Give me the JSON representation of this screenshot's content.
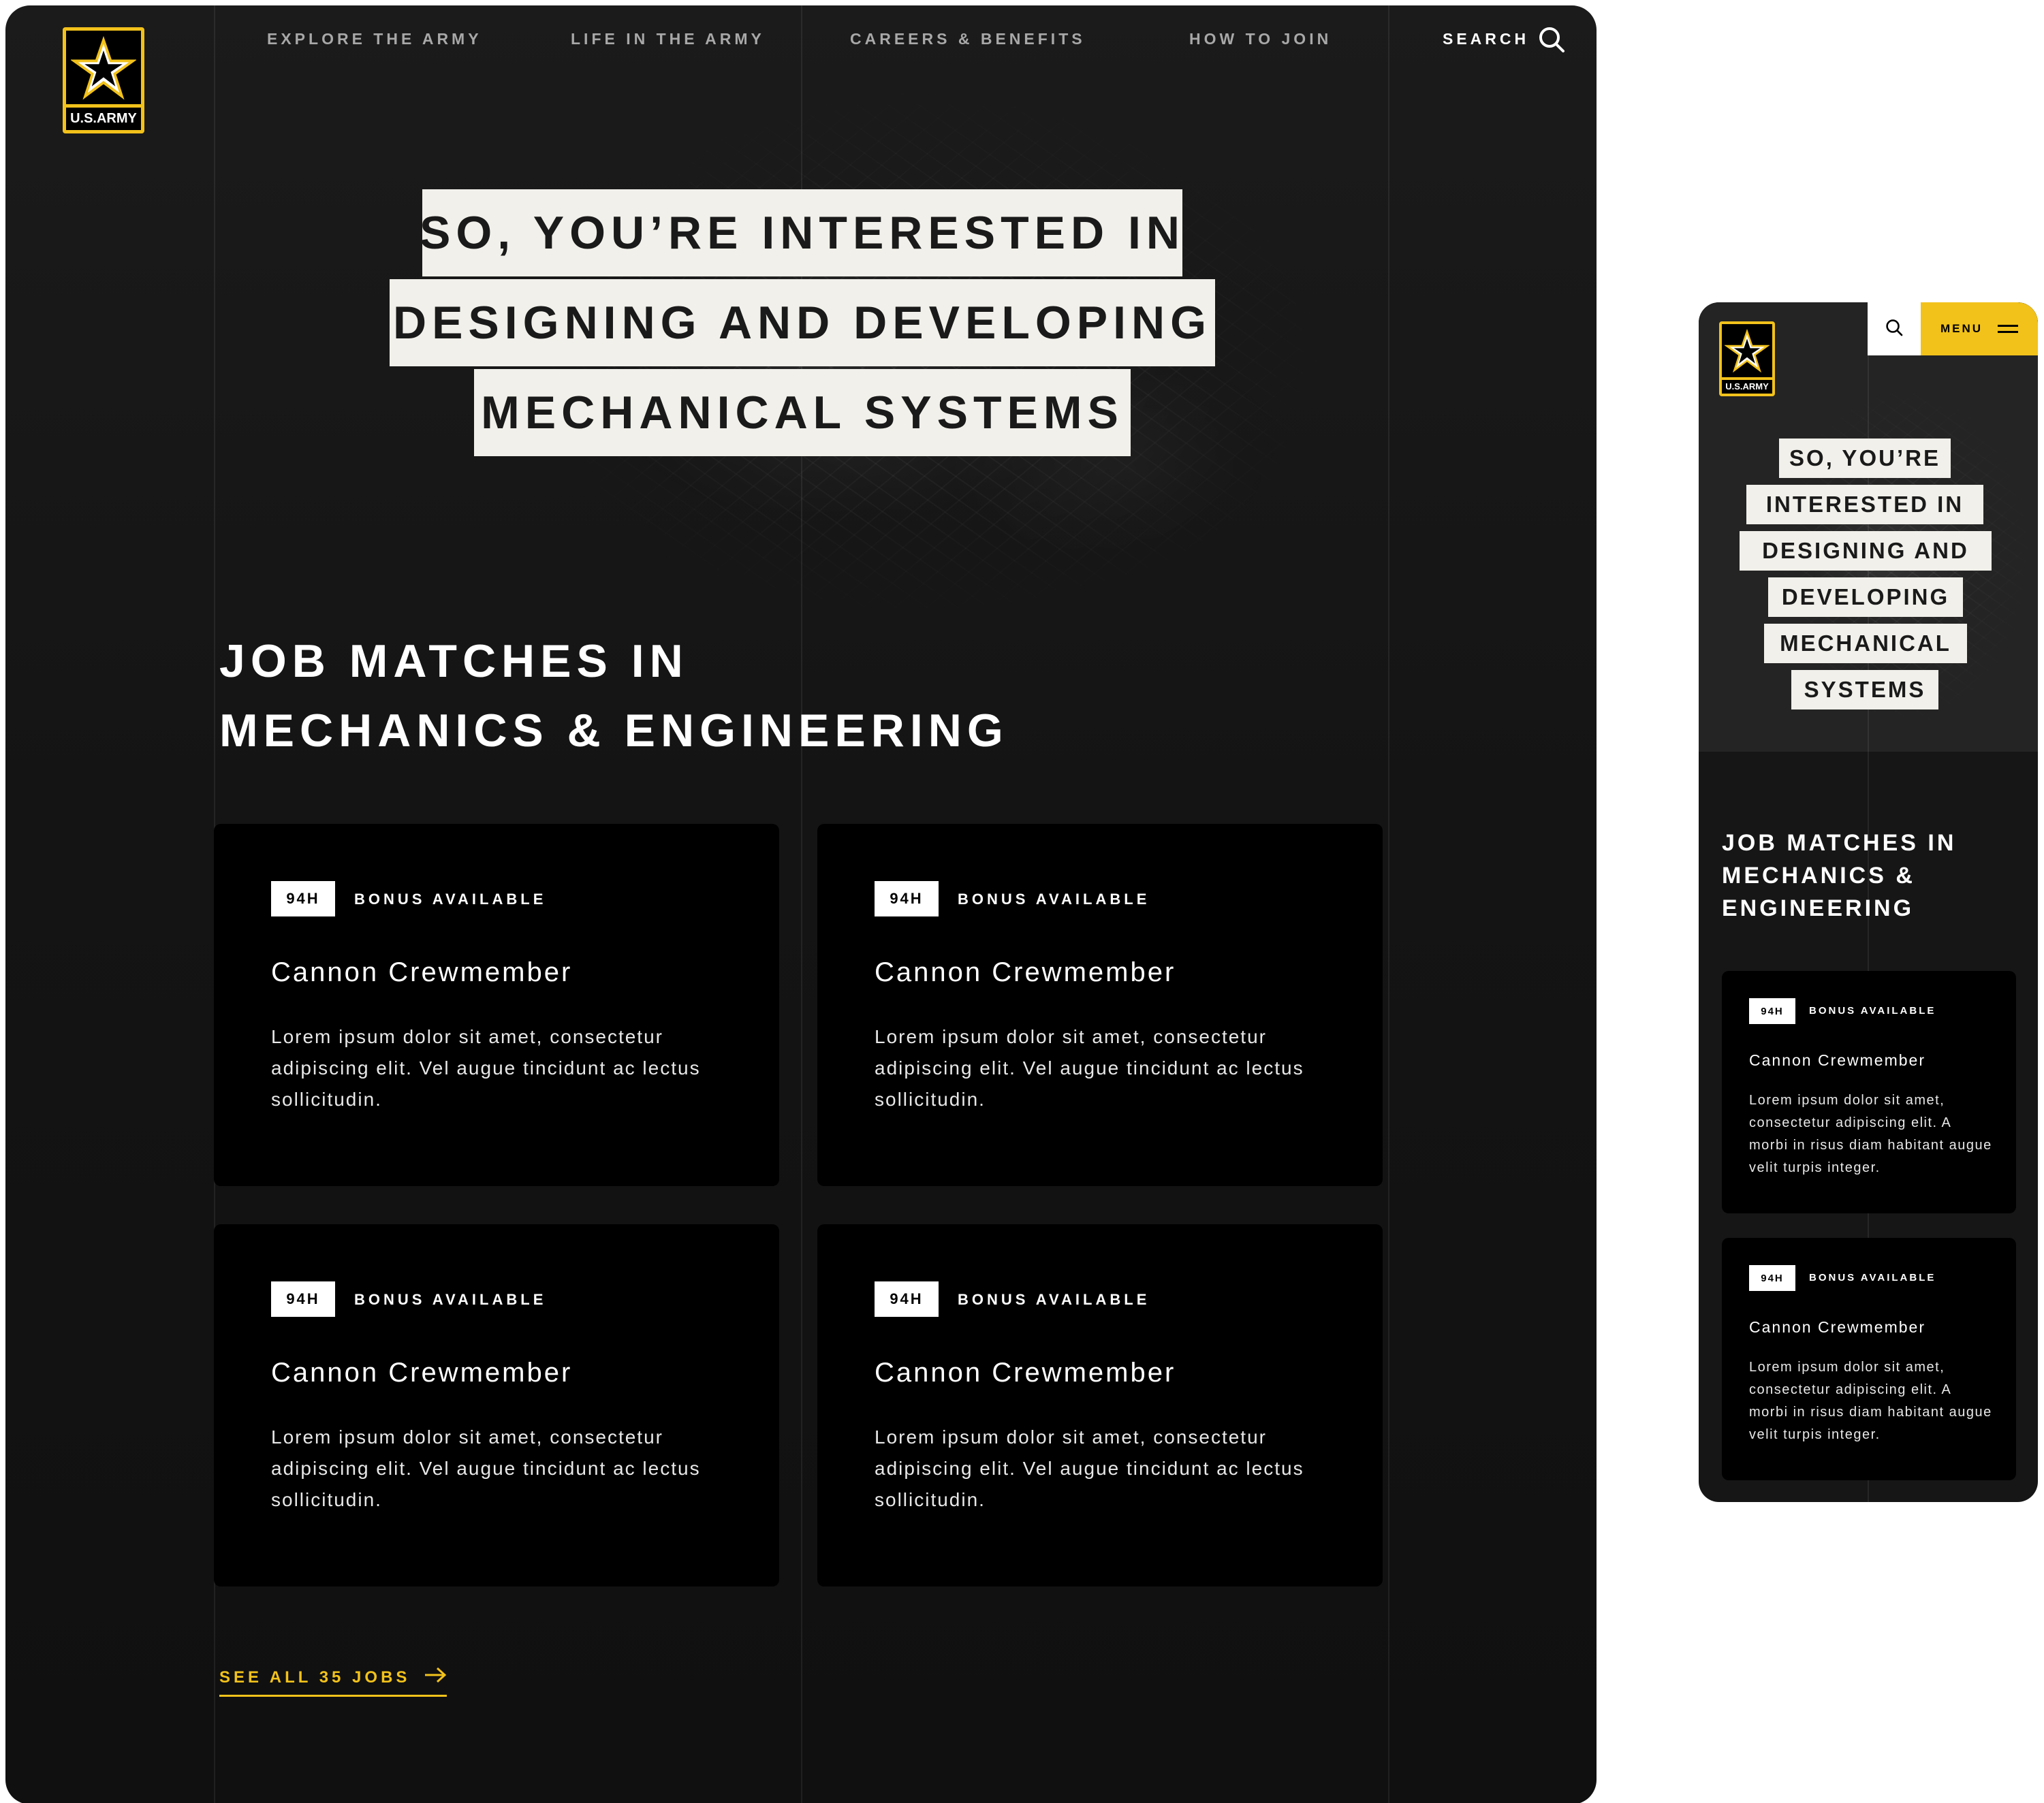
{
  "brand": {
    "logo_text": "U.S.ARMY",
    "accent_color": "#f2c21b",
    "background_color": "#141414",
    "tag_color": "#f1f0ea"
  },
  "nav": {
    "items": [
      {
        "label": "EXPLORE THE ARMY"
      },
      {
        "label": "LIFE IN THE ARMY"
      },
      {
        "label": "CAREERS & BENEFITS"
      },
      {
        "label": "HOW TO JOIN"
      }
    ],
    "search_label": "SEARCH",
    "search_icon": "search-icon",
    "menu_label": "MENU",
    "menu_icon": "menu-icon"
  },
  "hero": {
    "desktop_lines": [
      "SO, YOU’RE INTERESTED IN",
      "DESIGNING AND DEVELOPING",
      "MECHANICAL SYSTEMS"
    ],
    "mobile_lines": [
      "SO, YOU’RE",
      "INTERESTED IN",
      "DESIGNING AND",
      "DEVELOPING",
      "MECHANICAL",
      "SYSTEMS"
    ]
  },
  "section": {
    "desktop_title_lines": [
      "JOB MATCHES IN",
      "MECHANICS & ENGINEERING"
    ],
    "mobile_title_lines": [
      "JOB MATCHES IN",
      "MECHANICS &",
      "ENGINEERING"
    ]
  },
  "jobs_desktop": [
    {
      "code": "94H",
      "bonus": "BONUS AVAILABLE",
      "title": "Cannon Crewmember",
      "description": "Lorem ipsum dolor sit amet, consectetur adipiscing elit. Vel augue tincidunt ac lectus sollicitudin."
    },
    {
      "code": "94H",
      "bonus": "BONUS AVAILABLE",
      "title": "Cannon Crewmember",
      "description": "Lorem ipsum dolor sit amet, consectetur adipiscing elit. Vel augue tincidunt ac lectus sollicitudin."
    },
    {
      "code": "94H",
      "bonus": "BONUS AVAILABLE",
      "title": "Cannon Crewmember",
      "description": "Lorem ipsum dolor sit amet, consectetur adipiscing elit. Vel augue tincidunt ac lectus sollicitudin."
    },
    {
      "code": "94H",
      "bonus": "BONUS AVAILABLE",
      "title": "Cannon Crewmember",
      "description": "Lorem ipsum dolor sit amet, consectetur adipiscing elit. Vel augue tincidunt ac lectus sollicitudin."
    }
  ],
  "jobs_mobile": [
    {
      "code": "94H",
      "bonus": "BONUS AVAILABLE",
      "title": "Cannon Crewmember",
      "description": "Lorem ipsum dolor sit amet, consectetur adipiscing elit. A morbi in risus diam habitant augue velit turpis integer."
    },
    {
      "code": "94H",
      "bonus": "BONUS AVAILABLE",
      "title": "Cannon Crewmember",
      "description": "Lorem ipsum dolor sit amet, consectetur adipiscing elit. A morbi in risus diam habitant augue velit turpis integer."
    }
  ],
  "see_all": {
    "label": "SEE ALL 35 JOBS",
    "icon": "arrow-right-icon"
  }
}
